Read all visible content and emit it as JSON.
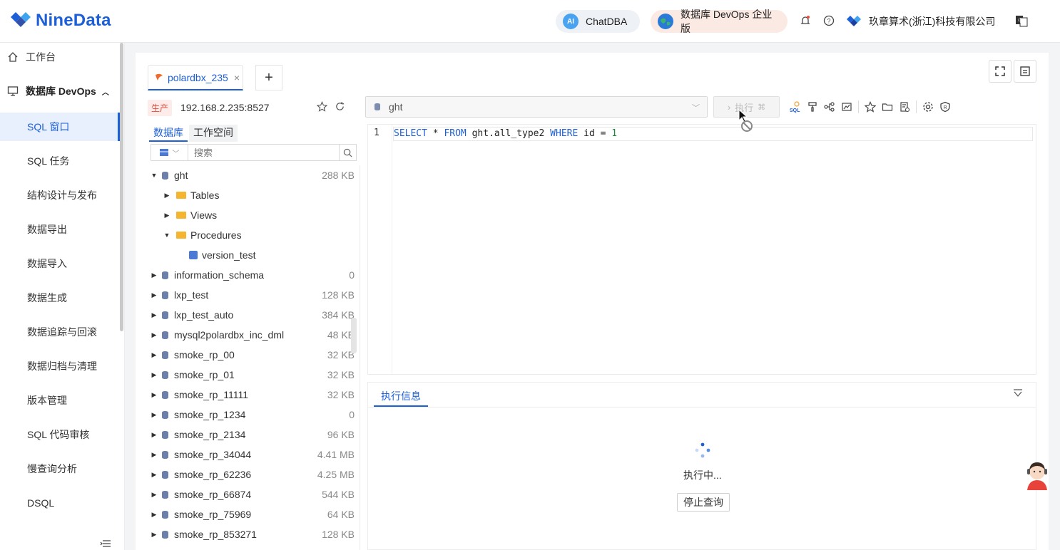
{
  "brand": {
    "name": "NineData"
  },
  "header": {
    "chatdba_label": "ChatDBA",
    "chatdba_badge": "AI",
    "devops_label": "数据库 DevOps 企业版",
    "org_name": "玖章算术(浙江)科技有限公司"
  },
  "sidebar": {
    "workbench": "工作台",
    "group": "数据库 DevOps",
    "items": [
      {
        "label": "SQL 窗口",
        "active": true
      },
      {
        "label": "SQL 任务"
      },
      {
        "label": "结构设计与发布"
      },
      {
        "label": "数据导出"
      },
      {
        "label": "数据导入"
      },
      {
        "label": "数据生成"
      },
      {
        "label": "数据追踪与回滚"
      },
      {
        "label": "数据归档与清理"
      },
      {
        "label": "版本管理"
      },
      {
        "label": "SQL 代码审核"
      },
      {
        "label": "慢查询分析"
      },
      {
        "label": "DSQL"
      }
    ]
  },
  "tabs": [
    {
      "label": "polardbx_235",
      "close": "×"
    }
  ],
  "tab_add": "+",
  "connection": {
    "env": "生产",
    "host": "192.168.2.235:8527"
  },
  "explorer": {
    "tabs": [
      "数据库",
      "工作空间"
    ],
    "search_placeholder": "搜索",
    "tree": [
      {
        "name": "ght",
        "size": "288 KB",
        "type": "db",
        "expanded": true,
        "depth": 0
      },
      {
        "name": "Tables",
        "type": "folder",
        "depth": 1
      },
      {
        "name": "Views",
        "type": "folder",
        "depth": 1
      },
      {
        "name": "Procedures",
        "type": "folder",
        "expanded": true,
        "depth": 1
      },
      {
        "name": "version_test",
        "type": "proc",
        "depth": 2
      },
      {
        "name": "information_schema",
        "size": "0",
        "type": "db",
        "depth": 0
      },
      {
        "name": "lxp_test",
        "size": "128 KB",
        "type": "db",
        "depth": 0
      },
      {
        "name": "lxp_test_auto",
        "size": "384 KB",
        "type": "db",
        "depth": 0
      },
      {
        "name": "mysql2polardbx_inc_dml",
        "size": "48 KB",
        "type": "db",
        "depth": 0
      },
      {
        "name": "smoke_rp_00",
        "size": "32 KB",
        "type": "db",
        "depth": 0
      },
      {
        "name": "smoke_rp_01",
        "size": "32 KB",
        "type": "db",
        "depth": 0
      },
      {
        "name": "smoke_rp_11111",
        "size": "32 KB",
        "type": "db",
        "depth": 0
      },
      {
        "name": "smoke_rp_1234",
        "size": "0",
        "type": "db",
        "depth": 0
      },
      {
        "name": "smoke_rp_2134",
        "size": "96 KB",
        "type": "db",
        "depth": 0
      },
      {
        "name": "smoke_rp_34044",
        "size": "4.41 MB",
        "type": "db",
        "depth": 0
      },
      {
        "name": "smoke_rp_62236",
        "size": "4.25 MB",
        "type": "db",
        "depth": 0
      },
      {
        "name": "smoke_rp_66874",
        "size": "544 KB",
        "type": "db",
        "depth": 0
      },
      {
        "name": "smoke_rp_75969",
        "size": "64 KB",
        "type": "db",
        "depth": 0
      },
      {
        "name": "smoke_rp_853271",
        "size": "128 KB",
        "type": "db",
        "depth": 0
      }
    ]
  },
  "editor": {
    "database": "ght",
    "run_label": "执行",
    "line_number": "1",
    "sql_tokens": [
      {
        "t": "SELECT",
        "k": "kw"
      },
      {
        "t": " * ",
        "k": "txt"
      },
      {
        "t": "FROM",
        "k": "kw"
      },
      {
        "t": " ght.all_type2 ",
        "k": "txt"
      },
      {
        "t": "WHERE",
        "k": "kw"
      },
      {
        "t": " id = ",
        "k": "txt"
      },
      {
        "t": "1",
        "k": "num"
      }
    ]
  },
  "result": {
    "tab_label": "执行信息",
    "status": "执行中...",
    "stop_label": "停止查询"
  },
  "colors": {
    "accent": "#1d5fd6",
    "env_badge": "#e04b3a",
    "folder": "#f5b52e"
  }
}
